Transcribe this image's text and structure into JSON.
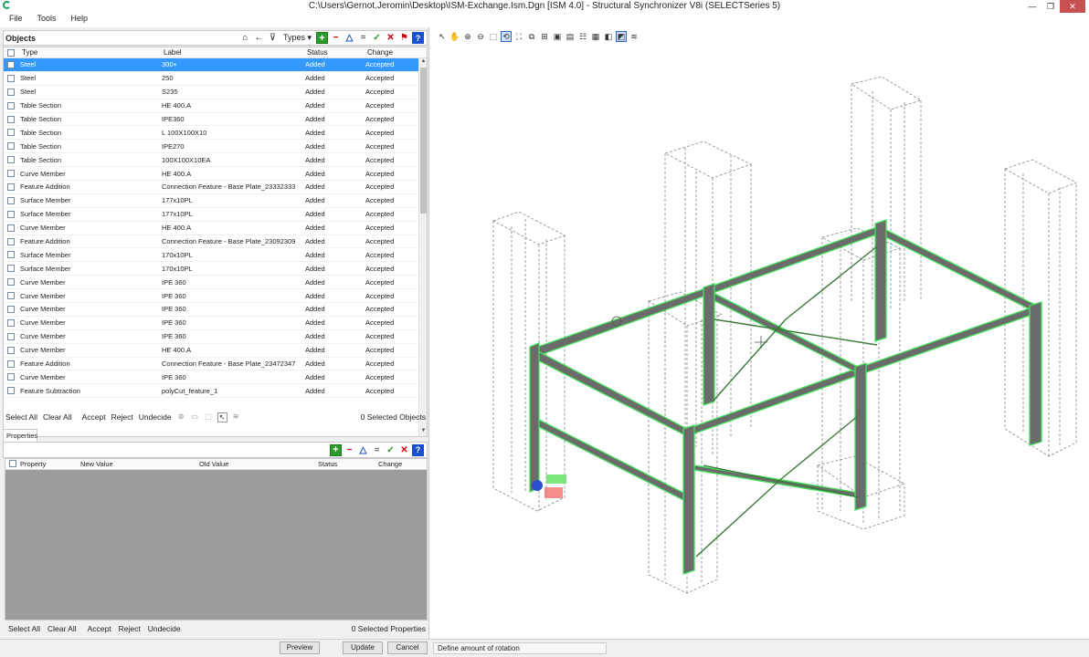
{
  "window": {
    "title": "C:\\Users\\Gernot.Jeromin\\Desktop\\ISM-Exchange.Ism.Dgn [ISM 4.0] - Structural Synchronizer V8i (SELECTSeries 5)",
    "minimize": "—",
    "maximize": "❐",
    "close": "✕"
  },
  "menu": [
    "File",
    "Tools",
    "Help"
  ],
  "objects": {
    "title": "Objects",
    "types_label": "Types",
    "columns": [
      "Type",
      "Label",
      "Status",
      "Change"
    ],
    "rows": [
      [
        "Steel",
        "300+",
        "Added",
        "Accepted"
      ],
      [
        "Steel",
        "250",
        "Added",
        "Accepted"
      ],
      [
        "Steel",
        "S235",
        "Added",
        "Accepted"
      ],
      [
        "Table Section",
        "HE 400.A",
        "Added",
        "Accepted"
      ],
      [
        "Table Section",
        "IPE360",
        "Added",
        "Accepted"
      ],
      [
        "Table Section",
        "L 100X100X10",
        "Added",
        "Accepted"
      ],
      [
        "Table Section",
        "IPE270",
        "Added",
        "Accepted"
      ],
      [
        "Table Section",
        "100X100X10EA",
        "Added",
        "Accepted"
      ],
      [
        "Curve Member",
        "HE 400.A",
        "Added",
        "Accepted"
      ],
      [
        "Feature Addition",
        "Connection Feature - Base Plate_23332333",
        "Added",
        "Accepted"
      ],
      [
        "Surface Member",
        "177x10PL",
        "Added",
        "Accepted"
      ],
      [
        "Surface Member",
        "177x10PL",
        "Added",
        "Accepted"
      ],
      [
        "Curve Member",
        "HE 400.A",
        "Added",
        "Accepted"
      ],
      [
        "Feature Addition",
        "Connection Feature - Base Plate_23092309",
        "Added",
        "Accepted"
      ],
      [
        "Surface Member",
        "170x10PL",
        "Added",
        "Accepted"
      ],
      [
        "Surface Member",
        "170x10PL",
        "Added",
        "Accepted"
      ],
      [
        "Curve Member",
        "IPE 360",
        "Added",
        "Accepted"
      ],
      [
        "Curve Member",
        "IPE 360",
        "Added",
        "Accepted"
      ],
      [
        "Curve Member",
        "IPE 360",
        "Added",
        "Accepted"
      ],
      [
        "Curve Member",
        "IPE 360",
        "Added",
        "Accepted"
      ],
      [
        "Curve Member",
        "IPE 360",
        "Added",
        "Accepted"
      ],
      [
        "Curve Member",
        "HE 400.A",
        "Added",
        "Accepted"
      ],
      [
        "Feature Addition",
        "Connection Feature - Base Plate_23472347",
        "Added",
        "Accepted"
      ],
      [
        "Curve Member",
        "IPE 360",
        "Added",
        "Accepted"
      ],
      [
        "Feature Subtraction",
        "polyCut_feature_1",
        "Added",
        "Accepted"
      ]
    ],
    "actions": [
      "Select All",
      "Clear All",
      "Accept",
      "Reject",
      "Undecide"
    ],
    "selected_count": "0 Selected Objects"
  },
  "properties": {
    "tab": "Properties",
    "columns": [
      "Property",
      "New Value",
      "Old Value",
      "Status",
      "Change"
    ],
    "actions": [
      "Select All",
      "Clear All",
      "Accept",
      "Reject",
      "Undecide"
    ],
    "selected_count": "0 Selected Properties"
  },
  "buttons": {
    "preview": "Preview",
    "update": "Update",
    "cancel": "Cancel"
  },
  "status_text": "Define amount of rotation",
  "colors": {
    "member": "#6b6b6b",
    "highlight": "#44e05a",
    "selection": "#3399ff"
  }
}
